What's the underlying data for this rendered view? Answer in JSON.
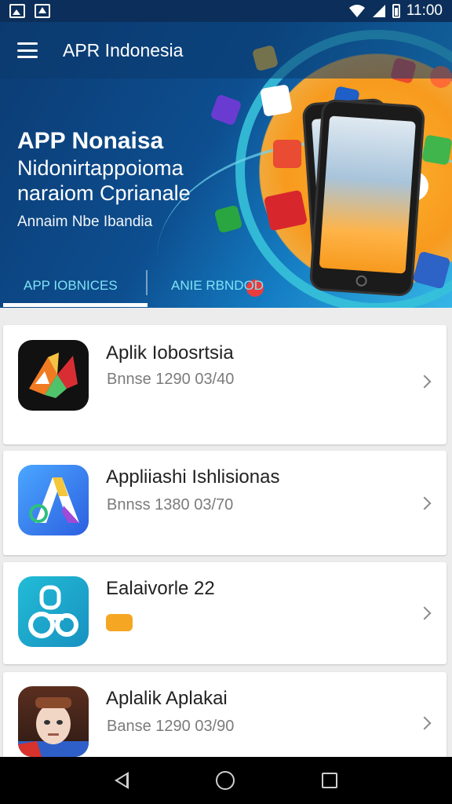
{
  "status_bar": {
    "time": "11:00",
    "icons": [
      "image-icon",
      "upload-icon",
      "wifi-icon",
      "signal-icon",
      "battery-icon"
    ]
  },
  "app_bar": {
    "title": "APR Indonesia",
    "menu_icon": "menu-icon"
  },
  "hero": {
    "title_line1": "APP Nonaisa",
    "title_line2": "Nidonirtappoioma",
    "title_line3": "naraiom Cprianale",
    "subtitle": "Annaim Nbe Ibandia",
    "accent_color": "#36c1d9",
    "bg_color": "#0d4e8f"
  },
  "tabs": [
    {
      "label": "APP IOBNICES",
      "active": true
    },
    {
      "label": "ANIE RBNDOD",
      "active": false
    }
  ],
  "apps": [
    {
      "name": "Aplik Iobosrtsia",
      "subtitle": "Bnnse 1290 03/40",
      "icon": "multicolor-fold-app-icon"
    },
    {
      "name": "Appliiashi Ishlisionas",
      "subtitle": "Bnnss 1380 03/70",
      "icon": "letter-a-app-icon"
    },
    {
      "name": "Ealaivorle 22",
      "subtitle": "",
      "icon": "lock-gear-app-icon",
      "badge_color": "#f5a623"
    },
    {
      "name": "Aplalik Aplakai",
      "subtitle": "Banse 1290 03/90",
      "icon": "avatar-app-icon"
    }
  ],
  "nav_bar": {
    "icons": [
      "back-icon",
      "home-icon",
      "recents-icon"
    ]
  }
}
